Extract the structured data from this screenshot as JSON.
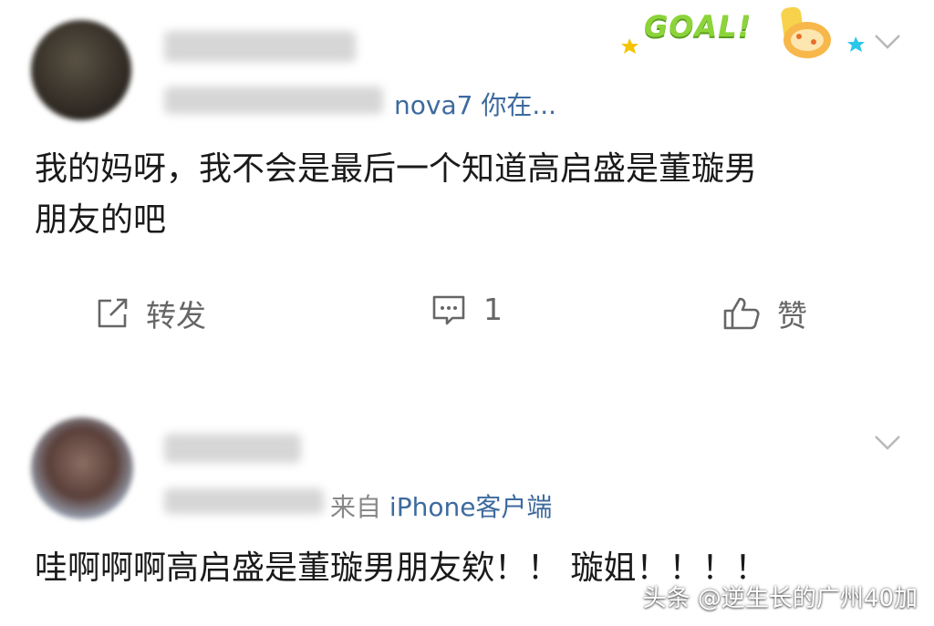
{
  "posts": [
    {
      "source_prefix": "",
      "source_device": "nova7 你在...",
      "content_line1": "我的妈呀，我不会是最后一个知道高启盛是董璇男",
      "content_line2": "朋友的吧",
      "actions": {
        "repost_label": "转发",
        "comment_count": "1",
        "like_label": "赞"
      },
      "badge_text": "GOAL!"
    },
    {
      "source_prefix": "来自",
      "source_device": "iPhone客户端",
      "content_line1": "哇啊啊啊高启盛是董璇男朋友欸！！ 璇姐！！！！"
    }
  ],
  "watermark": "头条 @逆生长的广州40加",
  "icons": [
    "repost-icon",
    "comment-icon",
    "like-icon",
    "chevron-down-icon",
    "goal-badge-icon"
  ]
}
